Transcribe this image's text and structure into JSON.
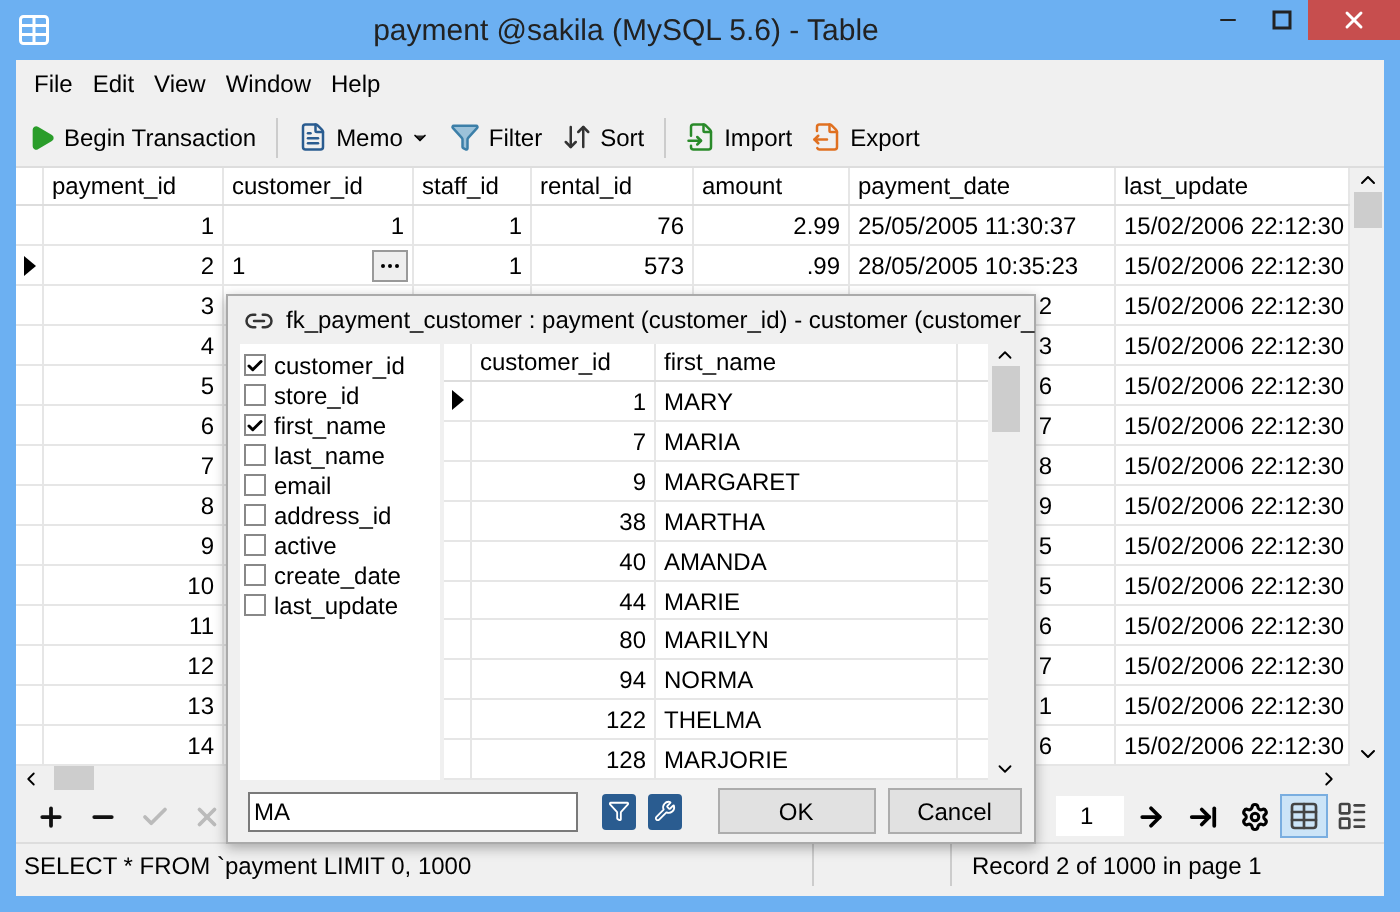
{
  "window": {
    "title": "payment @sakila (MySQL 5.6) - Table"
  },
  "menu": [
    "File",
    "Edit",
    "View",
    "Window",
    "Help"
  ],
  "toolbar": [
    {
      "kind": "transaction",
      "label": "Begin Transaction"
    },
    {
      "kind": "separator"
    },
    {
      "kind": "memo",
      "label": "Memo"
    },
    {
      "kind": "filter",
      "label": "Filter"
    },
    {
      "kind": "sort",
      "label": "Sort"
    },
    {
      "kind": "separator"
    },
    {
      "kind": "import",
      "label": "Import"
    },
    {
      "kind": "export",
      "label": "Export"
    }
  ],
  "grid": {
    "columns": [
      {
        "label": "payment_id",
        "kind": "number"
      },
      {
        "label": "customer_id",
        "kind": "number"
      },
      {
        "label": "staff_id",
        "kind": "number"
      },
      {
        "label": "rental_id",
        "kind": "number"
      },
      {
        "label": "amount",
        "kind": "number"
      },
      {
        "label": "payment_date",
        "kind": "text"
      },
      {
        "label": "last_update",
        "kind": "text"
      }
    ],
    "rows": [
      {
        "selected": false,
        "cells": [
          "1",
          "1",
          "1",
          "76",
          "2.99",
          "25/05/2005 11:30:37",
          "15/02/2006 22:12:30"
        ]
      },
      {
        "selected": true,
        "cells": [
          "2",
          {
            "kind": "editor",
            "text": "1"
          },
          "1",
          "573",
          ".99",
          "28/05/2005 10:35:23",
          "15/02/2006 22:12:30"
        ]
      },
      {
        "selected": false,
        "cells": [
          "3",
          null,
          null,
          null,
          null,
          {
            "kind": "cut",
            "text": "2"
          },
          "15/02/2006 22:12:30"
        ]
      },
      {
        "selected": false,
        "cells": [
          "4",
          null,
          null,
          null,
          null,
          {
            "kind": "cut",
            "text": "3"
          },
          "15/02/2006 22:12:30"
        ]
      },
      {
        "selected": false,
        "cells": [
          "5",
          null,
          null,
          null,
          null,
          {
            "kind": "cut",
            "text": "6"
          },
          "15/02/2006 22:12:30"
        ]
      },
      {
        "selected": false,
        "cells": [
          "6",
          null,
          null,
          null,
          null,
          {
            "kind": "cut",
            "text": "7"
          },
          "15/02/2006 22:12:30"
        ]
      },
      {
        "selected": false,
        "cells": [
          "7",
          null,
          null,
          null,
          null,
          {
            "kind": "cut",
            "text": "8"
          },
          "15/02/2006 22:12:30"
        ]
      },
      {
        "selected": false,
        "cells": [
          "8",
          null,
          null,
          null,
          null,
          {
            "kind": "cut",
            "text": "9"
          },
          "15/02/2006 22:12:30"
        ]
      },
      {
        "selected": false,
        "cells": [
          "9",
          null,
          null,
          null,
          null,
          {
            "kind": "cut",
            "text": "5"
          },
          "15/02/2006 22:12:30"
        ]
      },
      {
        "selected": false,
        "cells": [
          "10",
          null,
          null,
          null,
          null,
          {
            "kind": "cut",
            "text": "5"
          },
          "15/02/2006 22:12:30"
        ]
      },
      {
        "selected": false,
        "cells": [
          "11",
          null,
          null,
          null,
          null,
          {
            "kind": "cut",
            "text": "6"
          },
          "15/02/2006 22:12:30"
        ]
      },
      {
        "selected": false,
        "cells": [
          "12",
          null,
          null,
          null,
          null,
          {
            "kind": "cut",
            "text": "7"
          },
          "15/02/2006 22:12:30"
        ]
      },
      {
        "selected": false,
        "cells": [
          "13",
          null,
          null,
          null,
          null,
          {
            "kind": "cut",
            "text": "1"
          },
          "15/02/2006 22:12:30"
        ]
      },
      {
        "selected": false,
        "cells": [
          "14",
          null,
          null,
          null,
          null,
          {
            "kind": "cut",
            "text": "6"
          },
          "15/02/2006 22:12:30"
        ]
      }
    ]
  },
  "lookup": {
    "title": "fk_payment_customer : payment (customer_id) - customer (customer_",
    "fields": [
      {
        "label": "customer_id",
        "checked": true
      },
      {
        "label": "store_id",
        "checked": false
      },
      {
        "label": "first_name",
        "checked": true
      },
      {
        "label": "last_name",
        "checked": false
      },
      {
        "label": "email",
        "checked": false
      },
      {
        "label": "address_id",
        "checked": false
      },
      {
        "label": "active",
        "checked": false
      },
      {
        "label": "create_date",
        "checked": false
      },
      {
        "label": "last_update",
        "checked": false
      }
    ],
    "columns": [
      "customer_id",
      "first_name"
    ],
    "rows": [
      {
        "selected": true,
        "cells": [
          "1",
          "MARY"
        ]
      },
      {
        "selected": false,
        "cells": [
          "7",
          "MARIA"
        ]
      },
      {
        "selected": false,
        "cells": [
          "9",
          "MARGARET"
        ]
      },
      {
        "selected": false,
        "cells": [
          "38",
          "MARTHA"
        ]
      },
      {
        "selected": false,
        "cells": [
          "40",
          "AMANDA"
        ]
      },
      {
        "selected": false,
        "cells": [
          "44",
          "MARIE"
        ]
      },
      {
        "selected": false,
        "cells": [
          "80",
          "MARILYN"
        ]
      },
      {
        "selected": false,
        "cells": [
          "94",
          "NORMA"
        ]
      },
      {
        "selected": false,
        "cells": [
          "122",
          "THELMA"
        ]
      },
      {
        "selected": false,
        "cells": [
          "128",
          "MARJORIE"
        ]
      }
    ],
    "search": {
      "value": "MA"
    },
    "buttons": [
      "OK",
      "Cancel"
    ]
  },
  "bottom_tools": [
    {
      "kind": "add",
      "disabled": false
    },
    {
      "kind": "delete",
      "disabled": false
    },
    {
      "kind": "apply",
      "disabled": true
    },
    {
      "kind": "discard",
      "disabled": true
    }
  ],
  "pager": {
    "page": "1",
    "views": [
      {
        "kind": "grid",
        "selected": true
      },
      {
        "kind": "form",
        "selected": false
      }
    ]
  },
  "status_bar": {
    "query": "SELECT * FROM `payment  LIMIT 0, 1000",
    "record": "Record 2 of 1000 in page 1"
  }
}
